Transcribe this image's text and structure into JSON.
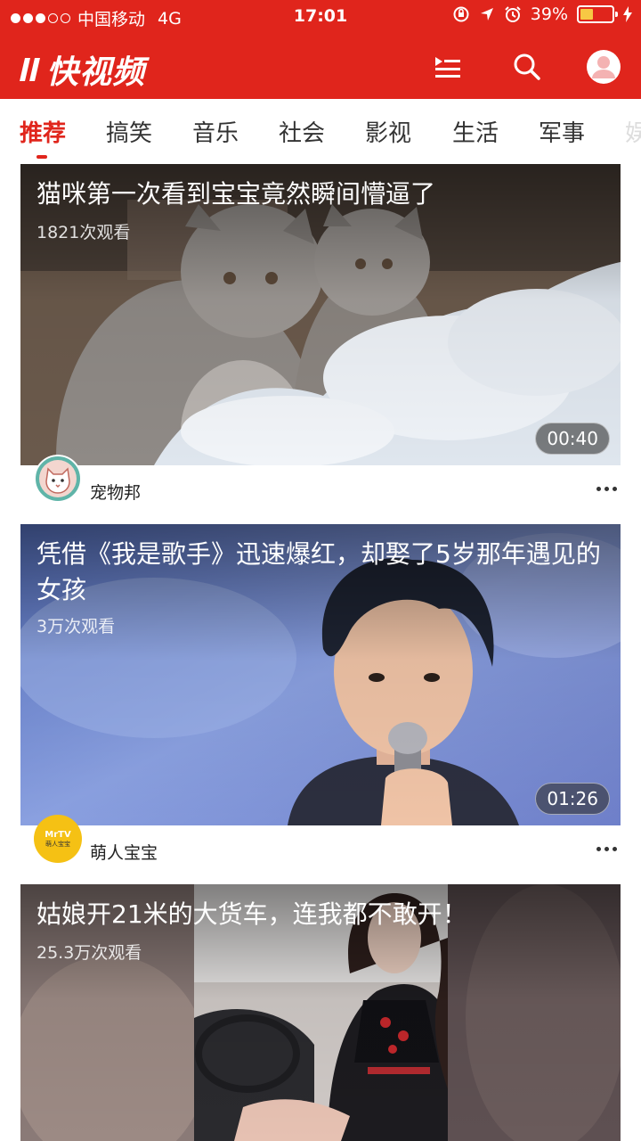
{
  "status_bar": {
    "carrier": "中国移动",
    "network": "4G",
    "time": "17:01",
    "battery": "39%"
  },
  "app": {
    "logo": "快视频",
    "icons": [
      "list-icon",
      "search-icon",
      "user-avatar-icon"
    ]
  },
  "tabs": [
    {
      "label": "推荐",
      "active": true
    },
    {
      "label": "搞笑"
    },
    {
      "label": "音乐"
    },
    {
      "label": "社会"
    },
    {
      "label": "影视"
    },
    {
      "label": "生活"
    },
    {
      "label": "军事"
    },
    {
      "label": "娱"
    }
  ],
  "videos": [
    {
      "title": "猫咪第一次看到宝宝竟然瞬间懵逼了",
      "views": "1821次观看",
      "duration": "00:40",
      "author": "宠物邦"
    },
    {
      "title": "凭借《我是歌手》迅速爆红，却娶了5岁那年遇见的女孩",
      "views": "3万次观看",
      "duration": "01:26",
      "author": "萌人宝宝",
      "author_badge": "MrTV",
      "author_badge_sub": "萌人宝宝"
    },
    {
      "title": "姑娘开21米的大货车，连我都不敢开！",
      "views": "25.3万次观看"
    }
  ],
  "colors": {
    "brand": "#e0251c",
    "battery": "#f7c844"
  }
}
